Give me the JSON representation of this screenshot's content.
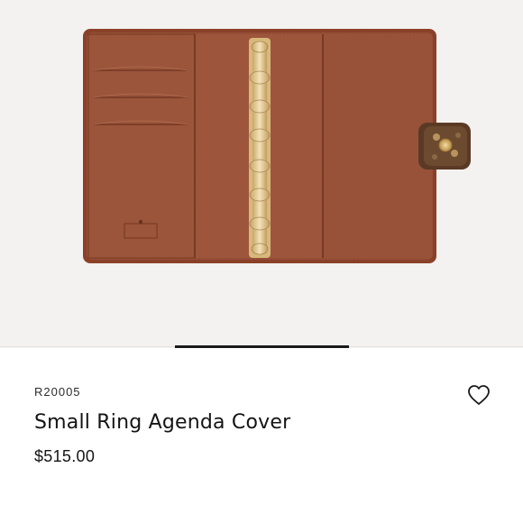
{
  "product": {
    "sku": "R20005",
    "name": "Small Ring Agenda Cover",
    "price": "$515.00"
  },
  "image": {
    "subject": "ring agenda cover product photo",
    "colors": {
      "canvas": "#8e4a2f",
      "leather": "#a05a3a",
      "rings": "#e4c88e",
      "background": "#f3f2f0"
    }
  },
  "gallery": {
    "position": 2,
    "count": 3
  },
  "icons": {
    "wishlist": "heart-outline-icon"
  }
}
